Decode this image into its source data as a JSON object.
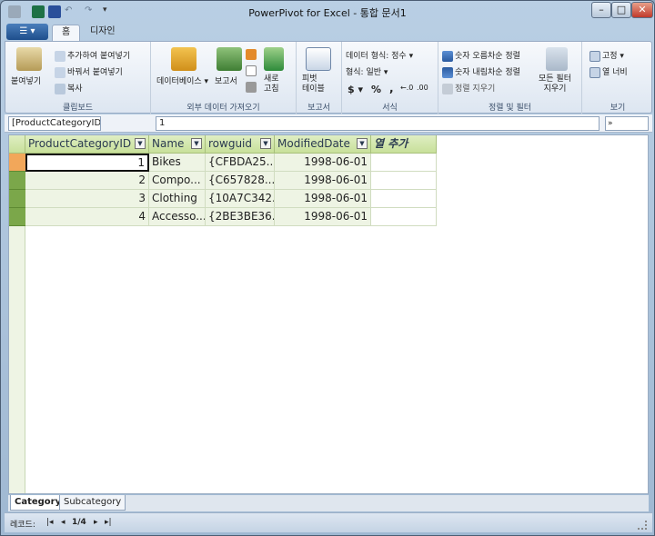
{
  "window": {
    "title": "PowerPivot for Excel - 통합 문서1"
  },
  "tabs": {
    "file": "",
    "home": "홈",
    "design": "디자인"
  },
  "ribbon": {
    "clipboard": {
      "paste": "붙여넣기",
      "paste_append": "추가하여 붙여넣기",
      "paste_replace": "바꿔서 붙여넣기",
      "copy": "복사",
      "label": "클립보드"
    },
    "external": {
      "database": "데이터베이스",
      "report": "보고서",
      "refresh": "새로\n고침",
      "label": "외부 데이터 가져오기"
    },
    "reports": {
      "pivot": "피벗\n테이블",
      "label": "보고서"
    },
    "format": {
      "datatype": "데이터 형식: 정수",
      "format": "형식: 일반",
      "currency": "$",
      "percent": "%",
      "comma": ",",
      "label": "서식"
    },
    "sort": {
      "asc": "숫자 오름차순 정렬",
      "desc": "숫자 내림차순 정렬",
      "clear_sort": "정렬 지우기",
      "clear_filters": "모든 필터\n지우기",
      "label": "정렬 및 필터"
    },
    "view": {
      "freeze": "고정",
      "width": "열 너비",
      "label": "보기"
    }
  },
  "formula": {
    "namebox": "[ProductCategoryID]",
    "value": "1"
  },
  "grid": {
    "columns": [
      "ProductCategoryID",
      "Name",
      "rowguid",
      "ModifiedDate",
      "열 추가"
    ],
    "rows": [
      [
        "1",
        "Bikes",
        "{CFBDA25...",
        "1998-06-01"
      ],
      [
        "2",
        "Compo...",
        "{C657828...",
        "1998-06-01"
      ],
      [
        "3",
        "Clothing",
        "{10A7C342...",
        "1998-06-01"
      ],
      [
        "4",
        "Accesso...",
        "{2BE3BE36...",
        "1998-06-01"
      ]
    ]
  },
  "sheets": [
    "Category",
    "Subcategory"
  ],
  "status": {
    "record_label": "레코드:",
    "record_pos": "1/4"
  }
}
